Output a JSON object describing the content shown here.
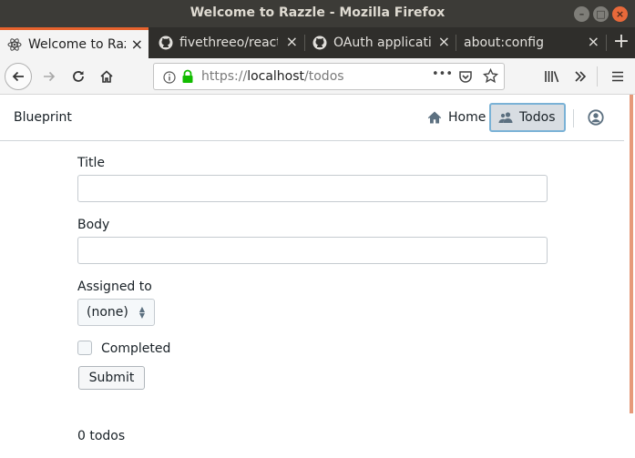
{
  "window": {
    "title": "Welcome to Razzle - Mozilla Firefox"
  },
  "tabs": [
    {
      "label": "Welcome to Razzle",
      "active": true,
      "favicon": "react-icon"
    },
    {
      "label": "fivethreeo/react",
      "active": false,
      "favicon": "github-icon"
    },
    {
      "label": "OAuth application",
      "active": false,
      "favicon": "github-icon"
    },
    {
      "label": "about:config",
      "active": false,
      "favicon": ""
    }
  ],
  "navbar": {
    "url_prefix": "https://",
    "url_host": "localhost",
    "url_path": "/todos",
    "more": "•••"
  },
  "app": {
    "brand": "Blueprint",
    "nav": {
      "home": "Home",
      "todos": "Todos"
    }
  },
  "form": {
    "title_label": "Title",
    "title_value": "",
    "body_label": "Body",
    "body_value": "",
    "assigned_label": "Assigned to",
    "assigned_value": "(none)",
    "completed_label": "Completed",
    "completed": false,
    "submit_label": "Submit"
  },
  "todos": {
    "count_text": "0 todos"
  },
  "colors": {
    "accent": "#e7632e",
    "selected_nav_border": "#7ab2d6"
  }
}
